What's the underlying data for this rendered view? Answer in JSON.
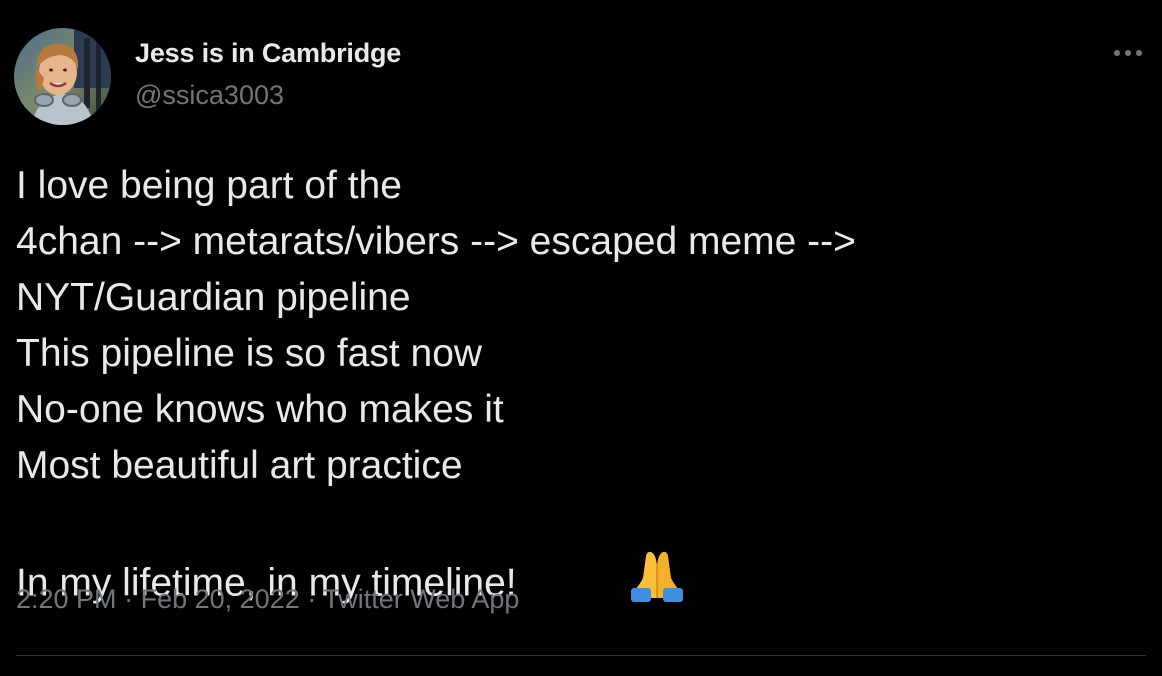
{
  "tweet": {
    "author": {
      "display_name": "Jess is in Cambridge",
      "handle": "@ssica3003",
      "avatar_icon": "avatar-photo"
    },
    "more_icon": "more-horizontal-icon",
    "lines": [
      "I love being part of the",
      "4chan --> metarats/vibers --> escaped meme -->",
      "NYT/Guardian pipeline",
      "This pipeline is so fast now",
      "No-one knows who makes it",
      "Most beautiful art practice",
      "In my lifetime, in my timeline!"
    ],
    "emoji": "🙏",
    "meta": {
      "time": "2:20 PM",
      "separator": "·",
      "date": "Feb 20, 2022",
      "source": "Twitter Web App"
    }
  },
  "colors": {
    "background": "#000000",
    "primary_text": "#e7e9ea",
    "secondary_text": "#71767b",
    "divider": "#2f3336"
  }
}
